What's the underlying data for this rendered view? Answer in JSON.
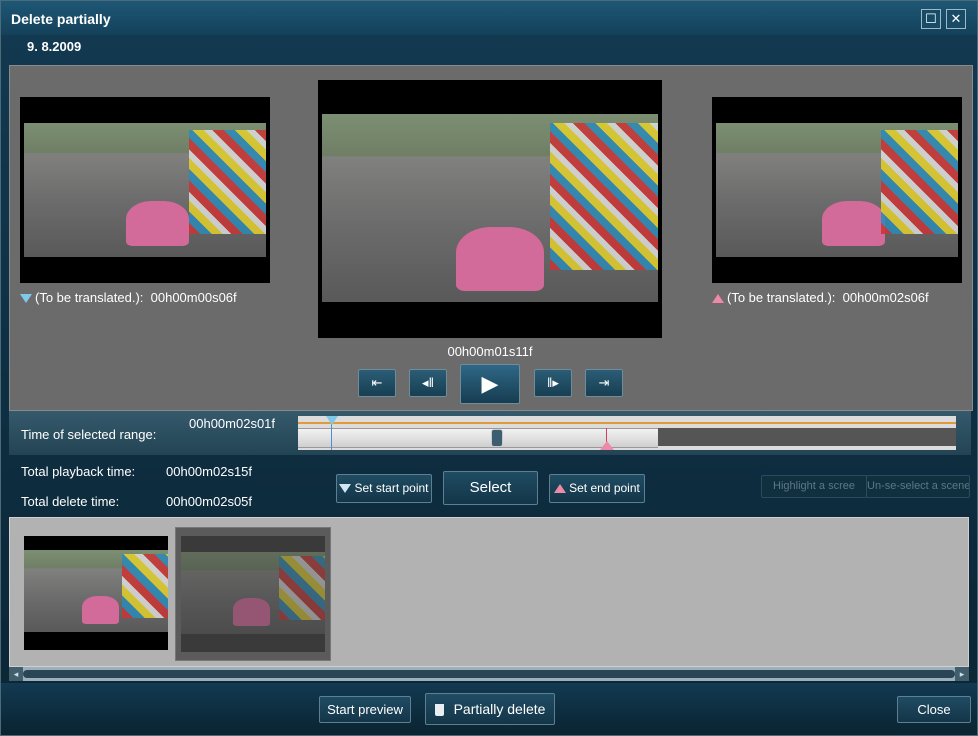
{
  "window": {
    "title": "Delete partially",
    "maximize_glyph": "☐",
    "close_glyph": "✕"
  },
  "header": {
    "date": "9. 8.2009"
  },
  "preview": {
    "start": {
      "label": "(To be translated.):",
      "time": "00h00m00s06f"
    },
    "end": {
      "label": "(To be translated.):",
      "time": "00h00m02s06f"
    },
    "current_time": "00h00m01s11f"
  },
  "controls": {
    "first_glyph": "⇤",
    "prev_glyph": "◂‖",
    "play_glyph": "▶",
    "next_glyph": "‖▸",
    "last_glyph": "⇥"
  },
  "range": {
    "label": "Time of selected range:",
    "value": "00h00m02s01f"
  },
  "totals": {
    "playback_label": "Total playback time:",
    "playback_value": "00h00m02s15f",
    "delete_label": "Total delete time:",
    "delete_value": "00h00m02s05f"
  },
  "buttons": {
    "set_start": "Set start point",
    "select": "Select",
    "set_end": "Set end point",
    "highlight": "Highlight a scree",
    "unselect": "Un-se-select a scene",
    "start_preview": "Start preview",
    "partially_delete": "Partially delete",
    "close": "Close"
  },
  "scroll": {
    "left_glyph": "◂",
    "right_glyph": "▸"
  },
  "colors": {
    "accent_start": "#7ec8e8",
    "accent_end": "#ee8aa8",
    "progress_line": "#e09a3a"
  }
}
